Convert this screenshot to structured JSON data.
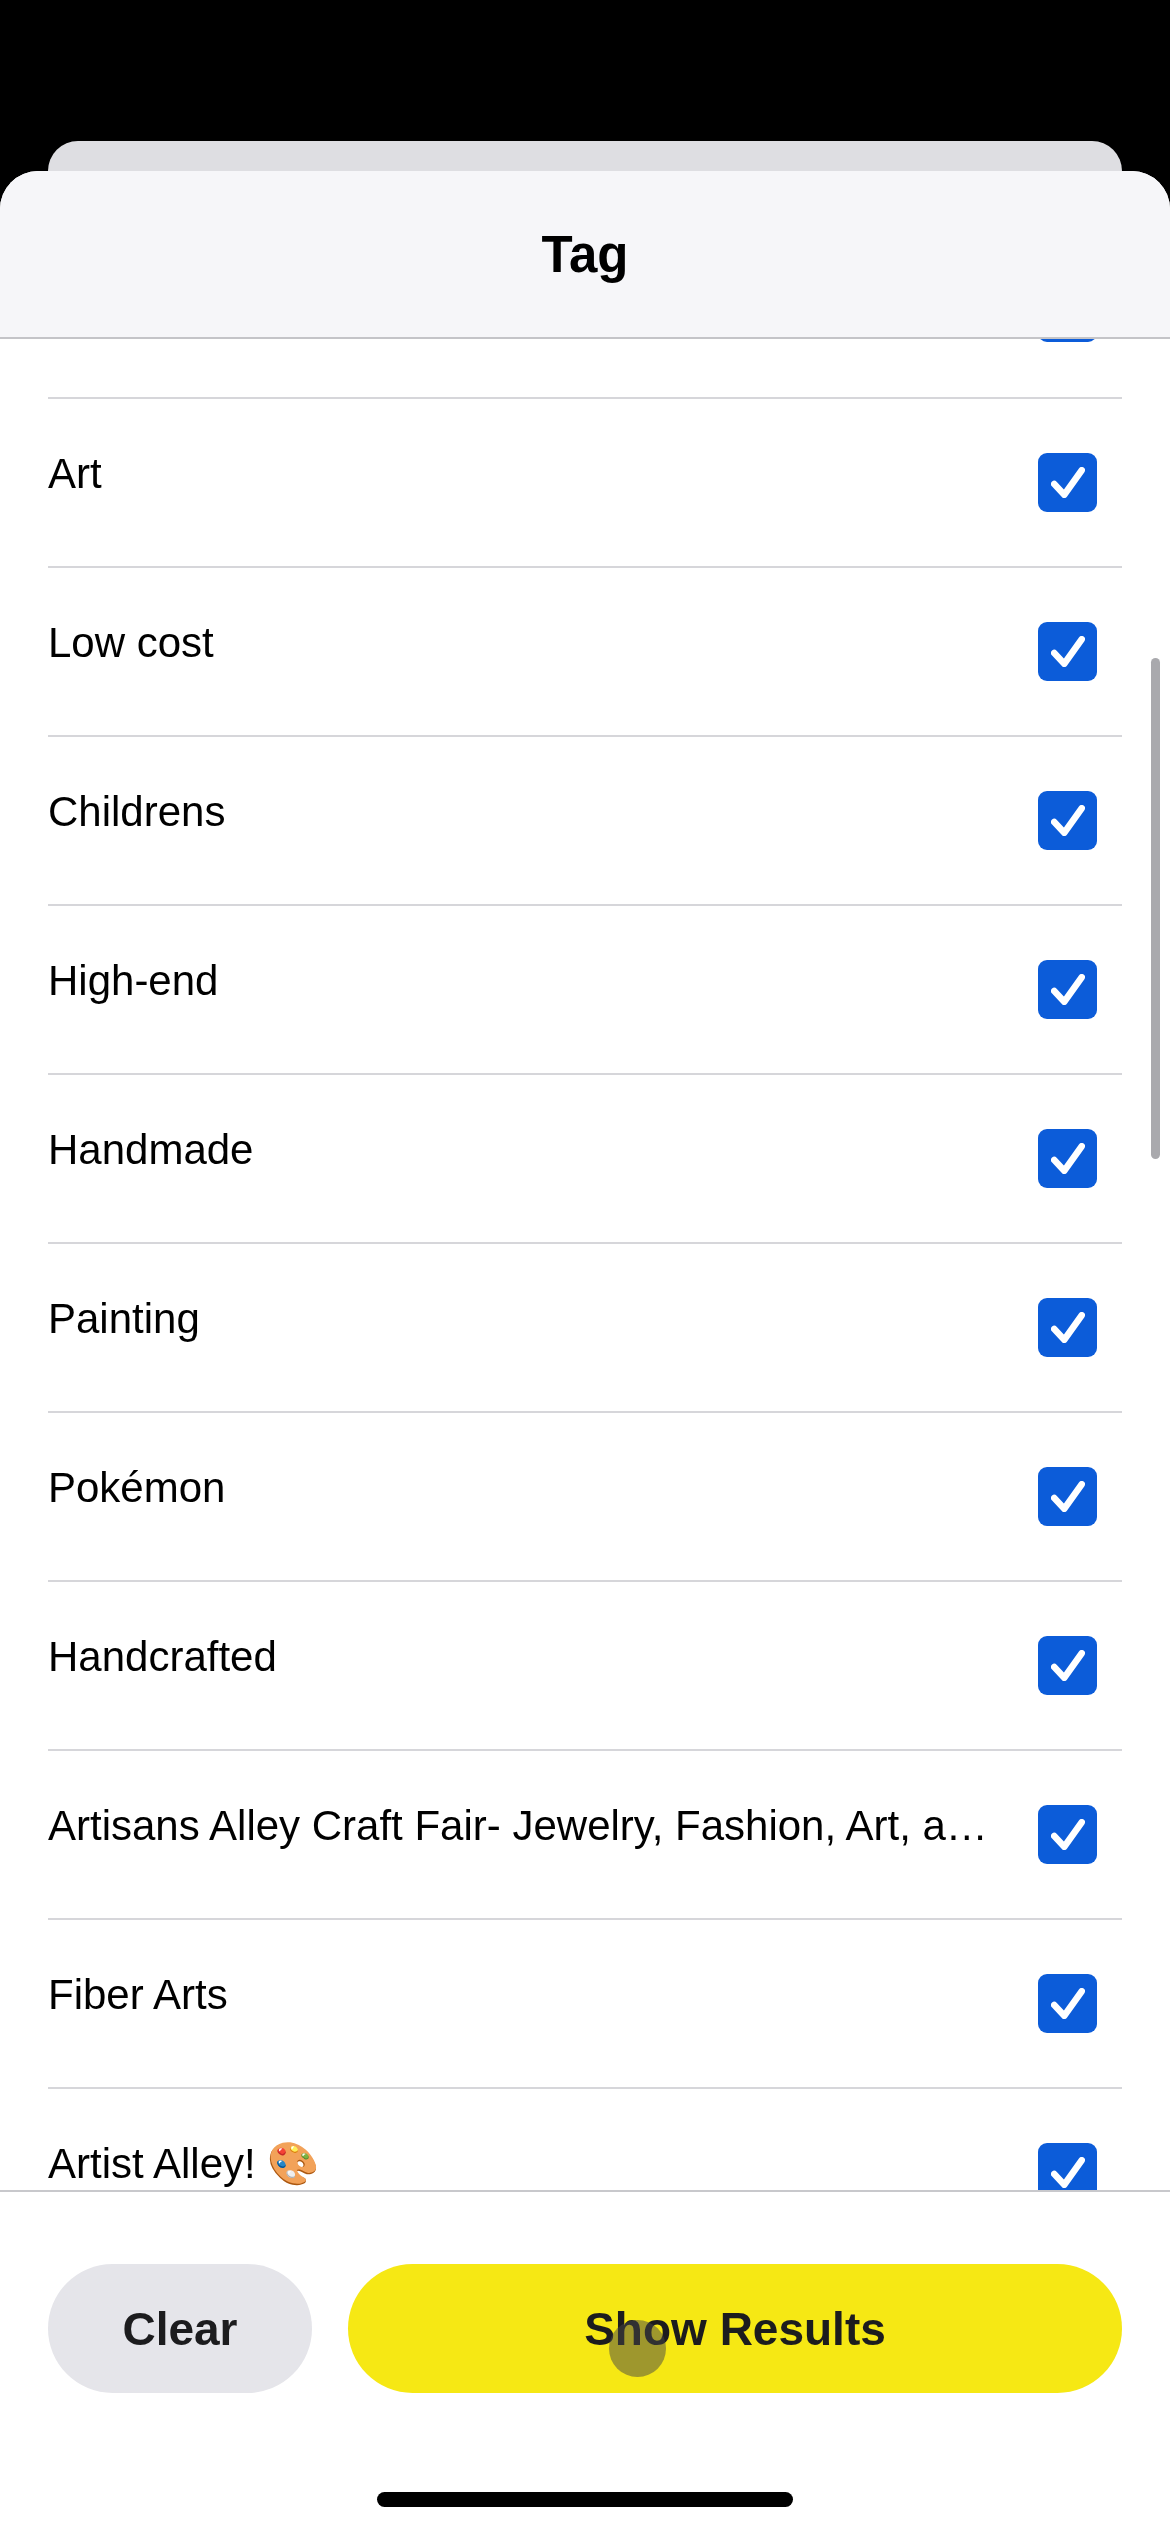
{
  "sheet": {
    "title": "Tag"
  },
  "tags": [
    {
      "checked": true
    },
    {
      "label": "Art",
      "checked": true
    },
    {
      "label": "Low cost",
      "checked": true
    },
    {
      "label": "Childrens",
      "checked": true
    },
    {
      "label": "High-end",
      "checked": true
    },
    {
      "label": "Handmade",
      "checked": true
    },
    {
      "label": "Painting",
      "checked": true
    },
    {
      "label": "Pokémon",
      "checked": true
    },
    {
      "label": "Handcrafted",
      "checked": true
    },
    {
      "label": "Artisans Alley Craft Fair- Jewelry, Fashion, Art, a…",
      "checked": true
    },
    {
      "label": "Fiber Arts",
      "checked": true
    },
    {
      "label": "Artist Alley! 🎨",
      "checked": true
    }
  ],
  "buttons": [
    {
      "kind": "secondary",
      "label": "Clear"
    },
    {
      "kind": "primary",
      "label": "Show Results"
    }
  ]
}
